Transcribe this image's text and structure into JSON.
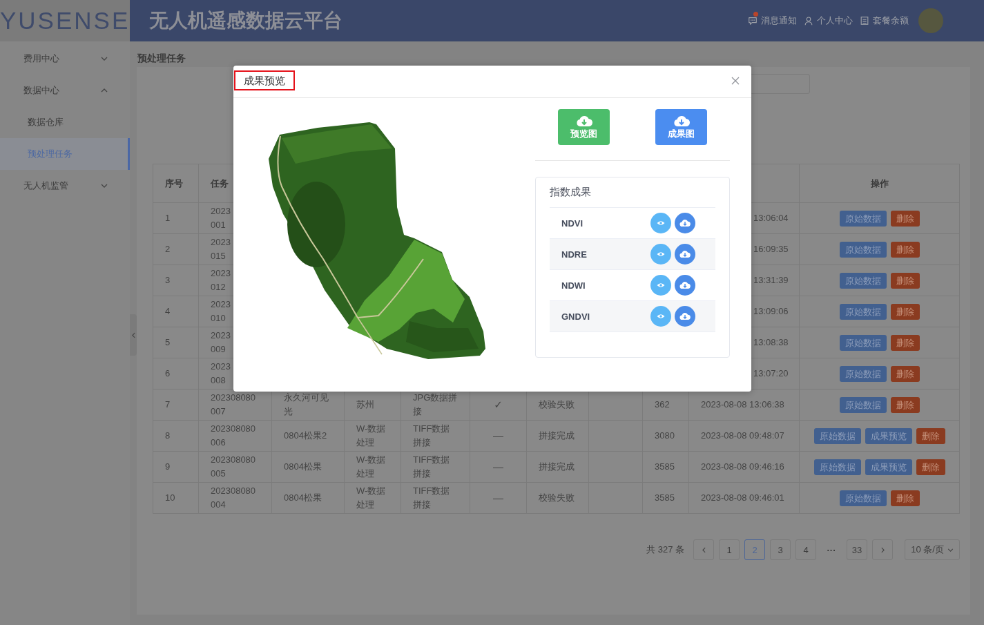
{
  "header": {
    "logo": "YUSENSE",
    "title": "无人机遥感数据云平台",
    "nav": [
      {
        "kind": "message",
        "label": "消息通知",
        "badge": true
      },
      {
        "kind": "user",
        "label": "个人中心",
        "badge": false
      },
      {
        "kind": "plan",
        "label": "套餐余额",
        "badge": false
      }
    ]
  },
  "sidebar": {
    "items": [
      {
        "label": "费用中心",
        "expanded": false
      },
      {
        "label": "数据中心",
        "expanded": true,
        "children": [
          {
            "label": "数据仓库",
            "selected": false
          },
          {
            "label": "预处理任务",
            "selected": true
          }
        ]
      },
      {
        "label": "无人机监管",
        "expanded": false
      }
    ]
  },
  "page_title": "预处理任务",
  "table": {
    "headers": {
      "index": "序号",
      "task_no": "任务",
      "actions": "操作"
    },
    "rows": [
      {
        "index": "1",
        "task_no": "2023\n001",
        "time_tail": "13:06:04",
        "actions": [
          {
            "kind": "raw",
            "label": "原始数据"
          },
          {
            "kind": "delete",
            "label": "删除"
          }
        ]
      },
      {
        "index": "2",
        "task_no": "2023\n015",
        "time_tail": "16:09:35",
        "actions": [
          {
            "kind": "raw",
            "label": "原始数据"
          },
          {
            "kind": "delete",
            "label": "删除"
          }
        ]
      },
      {
        "index": "3",
        "task_no": "2023\n012",
        "time_tail": "13:31:39",
        "actions": [
          {
            "kind": "raw",
            "label": "原始数据"
          },
          {
            "kind": "delete",
            "label": "删除"
          }
        ]
      },
      {
        "index": "4",
        "task_no": "2023\n010",
        "time_tail": "13:09:06",
        "actions": [
          {
            "kind": "raw",
            "label": "原始数据"
          },
          {
            "kind": "delete",
            "label": "删除"
          }
        ]
      },
      {
        "index": "5",
        "task_no": "2023\n009",
        "time_tail": "13:08:38",
        "actions": [
          {
            "kind": "raw",
            "label": "原始数据"
          },
          {
            "kind": "delete",
            "label": "删除"
          }
        ]
      },
      {
        "index": "6",
        "task_no": "2023\n008",
        "time_tail": "13:07:20",
        "actions": [
          {
            "kind": "raw",
            "label": "原始数据"
          },
          {
            "kind": "delete",
            "label": "删除"
          }
        ]
      },
      {
        "index": "7",
        "task_no": "202308080007",
        "name": "永久河可见光",
        "region": "苏州",
        "type": "JPG数据拼接",
        "mark": "✓",
        "status": "校验失败",
        "count": "362",
        "time": "2023-08-08 13:06:38",
        "actions": [
          {
            "kind": "raw",
            "label": "原始数据"
          },
          {
            "kind": "delete",
            "label": "删除"
          }
        ]
      },
      {
        "index": "8",
        "task_no": "202308080006",
        "name": "0804松果2",
        "region": "W-数据处理",
        "type": "TIFF数据拼接",
        "mark": "—",
        "status": "拼接完成",
        "count": "3080",
        "time": "2023-08-08 09:48:07",
        "actions": [
          {
            "kind": "raw",
            "label": "原始数据"
          },
          {
            "kind": "preview",
            "label": "成果预览"
          },
          {
            "kind": "delete",
            "label": "删除"
          }
        ]
      },
      {
        "index": "9",
        "task_no": "202308080005",
        "name": "0804松果",
        "region": "W-数据处理",
        "type": "TIFF数据拼接",
        "mark": "—",
        "status": "拼接完成",
        "count": "3585",
        "time": "2023-08-08 09:46:16",
        "actions": [
          {
            "kind": "raw",
            "label": "原始数据"
          },
          {
            "kind": "preview",
            "label": "成果预览"
          },
          {
            "kind": "delete",
            "label": "删除"
          }
        ]
      },
      {
        "index": "10",
        "task_no": "202308080004",
        "name": "0804松果",
        "region": "W-数据处理",
        "type": "TIFF数据拼接",
        "mark": "—",
        "status": "校验失败",
        "count": "3585",
        "time": "2023-08-08 09:46:01",
        "actions": [
          {
            "kind": "raw",
            "label": "原始数据"
          },
          {
            "kind": "delete",
            "label": "删除"
          }
        ]
      }
    ]
  },
  "pagination": {
    "total": "共 327 条",
    "pages": [
      {
        "kind": "page",
        "label": "1",
        "selected": false
      },
      {
        "kind": "page",
        "label": "2",
        "selected": true
      },
      {
        "kind": "page",
        "label": "3",
        "selected": false
      },
      {
        "kind": "page",
        "label": "4",
        "selected": false
      },
      {
        "kind": "ellipsis",
        "label": "···"
      },
      {
        "kind": "page",
        "label": "33",
        "selected": false
      }
    ],
    "page_size": "10 条/页"
  },
  "dialog": {
    "title": "成果预览",
    "downloads": [
      {
        "kind": "preview",
        "label": "预览图"
      },
      {
        "kind": "result",
        "label": "成果图"
      }
    ],
    "index_results": {
      "title": "指数成果",
      "items": [
        {
          "name": "NDVI"
        },
        {
          "name": "NDRE"
        },
        {
          "name": "NDWI"
        },
        {
          "name": "GNDVI"
        }
      ]
    }
  }
}
